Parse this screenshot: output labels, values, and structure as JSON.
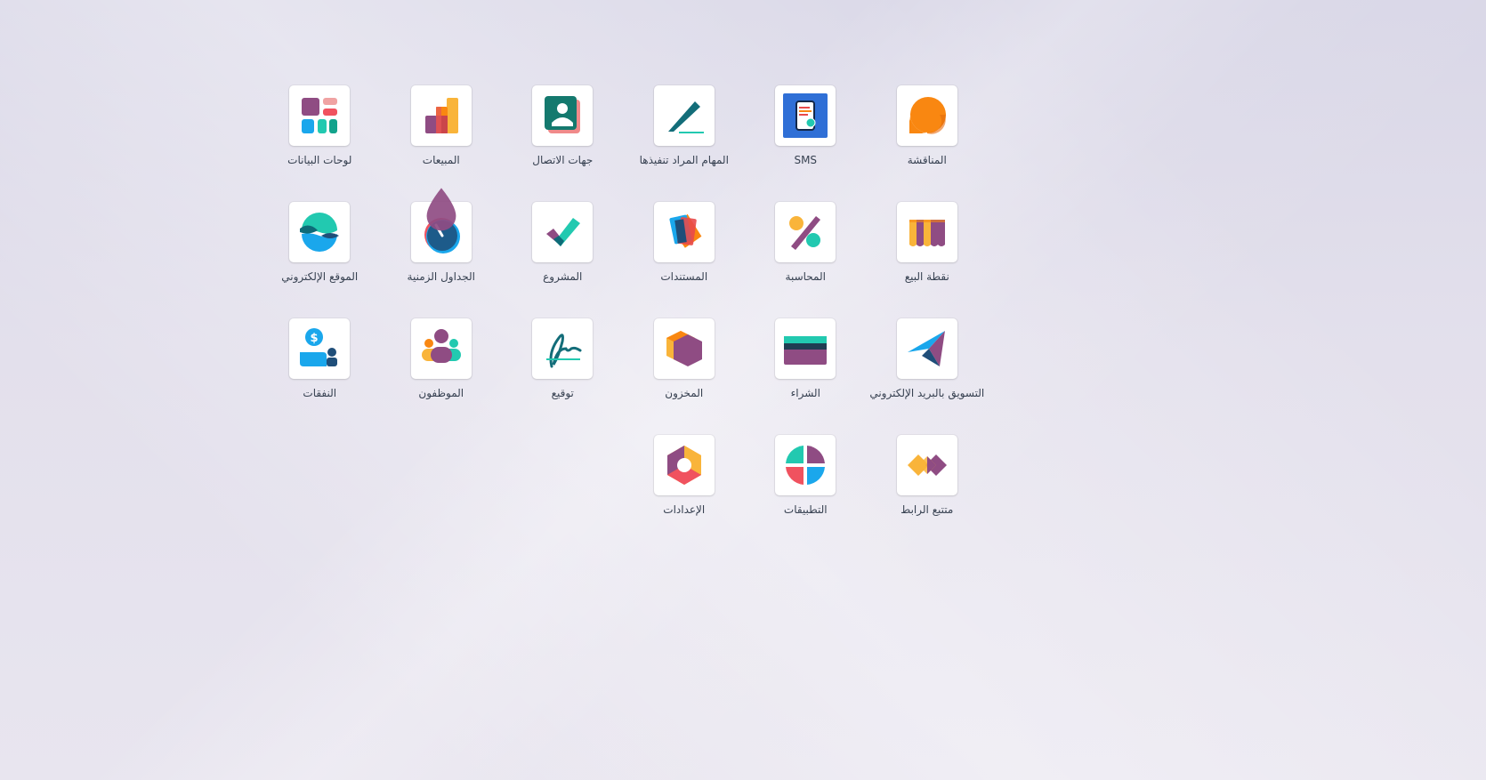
{
  "apps": [
    {
      "name": "discuss",
      "label": "المناقشة",
      "icon": "discuss-icon"
    },
    {
      "name": "sms",
      "label": "SMS",
      "icon": "sms-icon"
    },
    {
      "name": "todo",
      "label": "المهام المراد تنفيذها",
      "icon": "todo-icon"
    },
    {
      "name": "contacts",
      "label": "جهات الاتصال",
      "icon": "contacts-icon"
    },
    {
      "name": "sales",
      "label": "المبيعات",
      "icon": "sales-icon"
    },
    {
      "name": "dashboards",
      "label": "لوحات البيانات",
      "icon": "dashboards-icon"
    },
    {
      "name": "pos",
      "label": "نقطة البيع",
      "icon": "point-of-sale-icon"
    },
    {
      "name": "accounting",
      "label": "المحاسبة",
      "icon": "accounting-icon"
    },
    {
      "name": "documents",
      "label": "المستندات",
      "icon": "documents-icon"
    },
    {
      "name": "project",
      "label": "المشروع",
      "icon": "project-icon"
    },
    {
      "name": "timesheets",
      "label": "الجداول الزمنية",
      "icon": "timesheets-icon"
    },
    {
      "name": "website",
      "label": "الموقع الإلكتروني",
      "icon": "website-icon"
    },
    {
      "name": "email-marketing",
      "label": "التسويق بالبريد الإلكتروني",
      "icon": "email-marketing-icon"
    },
    {
      "name": "purchase",
      "label": "الشراء",
      "icon": "purchase-icon"
    },
    {
      "name": "inventory",
      "label": "المخزون",
      "icon": "inventory-icon"
    },
    {
      "name": "sign",
      "label": "توقيع",
      "icon": "sign-icon"
    },
    {
      "name": "employees",
      "label": "الموظفون",
      "icon": "employees-icon"
    },
    {
      "name": "expenses",
      "label": "النفقات",
      "icon": "expenses-icon"
    },
    {
      "name": "link-tracker",
      "label": "متتبع الرابط",
      "icon": "link-tracker-icon"
    },
    {
      "name": "apps",
      "label": "التطبيقات",
      "icon": "apps-icon"
    },
    {
      "name": "settings",
      "label": "الإعدادات",
      "icon": "settings-icon"
    }
  ],
  "colors": {
    "purple": "#8f4c83",
    "teal": "#22c9b0",
    "orange": "#f98711",
    "yellow": "#f9b43a",
    "red": "#f0525f",
    "blue": "#1aa7ec",
    "navy": "#1f4e79",
    "dark_teal": "#0e6b78"
  }
}
